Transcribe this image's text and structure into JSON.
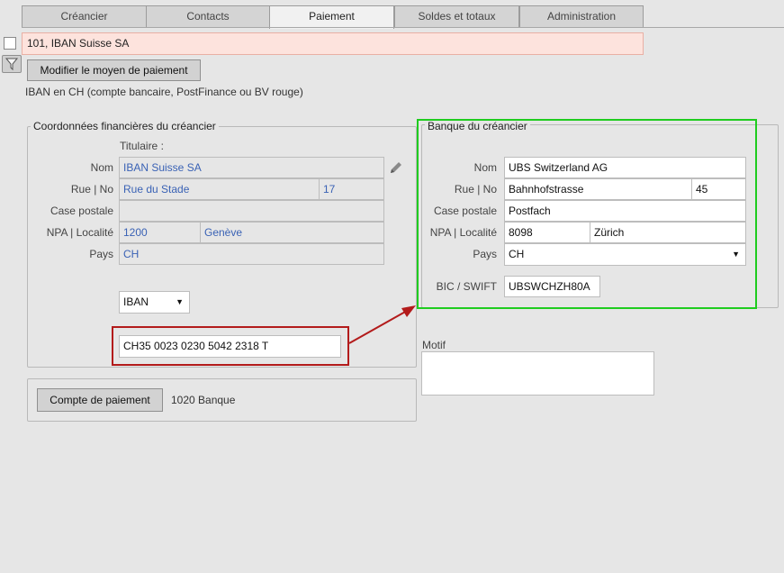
{
  "tabs": [
    "Créancier",
    "Contacts",
    "Paiement",
    "Soldes et totaux",
    "Administration"
  ],
  "active_tab": "Paiement",
  "header": {
    "title_value": "101, IBAN Suisse SA",
    "modify_button": "Modifier le moyen de paiement",
    "payment_desc": "IBAN en CH (compte bancaire, PostFinance ou BV rouge)"
  },
  "creditor": {
    "section_title": "Coordonnées financières du créancier",
    "holder_label": "Titulaire :",
    "labels": {
      "name": "Nom",
      "street": "Rue | No",
      "po_box": "Case postale",
      "zip_city": "NPA | Localité",
      "country": "Pays"
    },
    "name": "IBAN Suisse SA",
    "street": "Rue du Stade",
    "street_no": "17",
    "po_box": "",
    "zip": "1200",
    "city": "Genève",
    "country": "CH",
    "account_type": "IBAN",
    "iban": "CH35 0023 0230 5042 2318 T"
  },
  "bank": {
    "section_title": "Banque du créancier",
    "labels": {
      "name": "Nom",
      "street": "Rue | No",
      "po_box": "Case postale",
      "zip_city": "NPA | Localité",
      "country": "Pays",
      "bic": "BIC / SWIFT"
    },
    "name": "UBS Switzerland AG",
    "street": "Bahnhofstrasse",
    "street_no": "45",
    "po_box": "Postfach",
    "zip": "8098",
    "city": "Zürich",
    "country": "CH",
    "bic": "UBSWCHZH80A"
  },
  "motif": {
    "label": "Motif",
    "value": ""
  },
  "payment_account": {
    "button": "Compte de paiement",
    "value": "1020 Banque"
  },
  "colors": {
    "highlight_green": "#1fcc1f",
    "highlight_red": "#b31b1b",
    "title_bg": "#fde3dd",
    "link_text": "#3a62b5"
  }
}
